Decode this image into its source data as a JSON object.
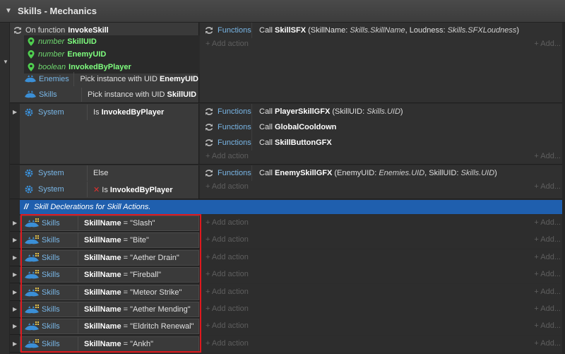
{
  "group": {
    "title": "Skills - Mechanics"
  },
  "function_block": {
    "label_prefix": "On function",
    "name": "InvokeSkill",
    "params": [
      {
        "type": "number",
        "name": "SkillUID"
      },
      {
        "type": "number",
        "name": "EnemyUID"
      },
      {
        "type": "boolean",
        "name": "InvokedByPlayer"
      }
    ],
    "conditions": [
      {
        "object": "Enemies",
        "text": "Pick instance with UID",
        "bold": "EnemyUID"
      },
      {
        "object": "Skills",
        "text": "Pick instance with UID",
        "bold": "SkillUID"
      }
    ],
    "actions": [
      {
        "object": "Functions",
        "call": "Call",
        "name": "SkillSFX",
        "open": " (SkillName: ",
        "a1": "Skills.SkillName",
        "mid": ", Loudness: ",
        "a2": "Skills.SFXLoudness",
        "close": ")"
      }
    ]
  },
  "system_block": {
    "object": "System",
    "cond_prefix": "Is",
    "cond_bold": "InvokedByPlayer",
    "actions": [
      {
        "object": "Functions",
        "call": "Call",
        "name": "PlayerSkillGFX",
        "open": " (SkillUID: ",
        "a1": "Skills.UID",
        "close": ")"
      },
      {
        "object": "Functions",
        "call": "Call",
        "name": "GlobalCooldown"
      },
      {
        "object": "Functions",
        "call": "Call",
        "name": "SkillButtonGFX"
      }
    ]
  },
  "else_block": {
    "conditions": [
      {
        "object": "System",
        "text": "Else"
      },
      {
        "object": "System",
        "invert": "✕",
        "text": "Is",
        "bold": "InvokedByPlayer"
      }
    ],
    "actions": [
      {
        "object": "Functions",
        "call": "Call",
        "name": "EnemySkillGFX",
        "open": " (EnemyUID: ",
        "a1": "Enemies.UID",
        "mid": ", SkillUID: ",
        "a2": "Skills.UID",
        "close": ")"
      }
    ]
  },
  "comment": {
    "slashes": "//",
    "text": "Skill Declerations for Skill Actions."
  },
  "skills": {
    "object": "Skills",
    "var": "SkillName",
    "eq": "=",
    "rows": [
      "\"Slash\"",
      "\"Bite\"",
      "\"Aether Drain\"",
      "\"Fireball\"",
      "\"Meteor Strike\"",
      "\"Aether Mending\"",
      "\"Eldritch Renewal\"",
      "\"Ankh\""
    ]
  },
  "labels": {
    "add_action": "+ Add action",
    "add_right": "+ Add..."
  },
  "colors": {
    "accent_blue": "#1f5fae",
    "highlight_red": "#e0191e",
    "param_green": "#7fff7f",
    "object_blue": "#79b6e6"
  }
}
